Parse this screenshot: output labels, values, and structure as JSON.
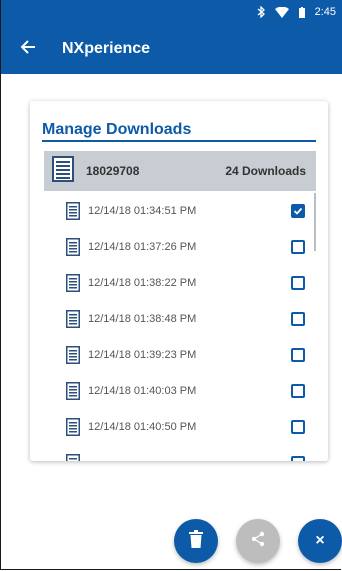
{
  "status_bar": {
    "time": "2:45",
    "icons": [
      "bluetooth-icon",
      "wifi-icon",
      "battery-icon"
    ]
  },
  "app_bar": {
    "title": "NXperience",
    "back_icon": "arrow-left-icon"
  },
  "card": {
    "title": "Manage Downloads",
    "group": {
      "name": "18029708",
      "count": "24 Downloads"
    },
    "downloads": [
      {
        "label": "12/14/18 01:34:51 PM",
        "checked": true
      },
      {
        "label": "12/14/18 01:37:26 PM",
        "checked": false
      },
      {
        "label": "12/14/18 01:38:22 PM",
        "checked": false
      },
      {
        "label": "12/14/18 01:38:48 PM",
        "checked": false
      },
      {
        "label": "12/14/18 01:39:23 PM",
        "checked": false
      },
      {
        "label": "12/14/18 01:40:03 PM",
        "checked": false
      },
      {
        "label": "12/14/18 01:40:50 PM",
        "checked": false
      },
      {
        "label": "",
        "checked": false
      }
    ]
  },
  "fabs": {
    "delete": {
      "icon": "trash-icon",
      "color": "#0d5ba8"
    },
    "share": {
      "icon": "share-icon",
      "color": "#bdbdbd"
    },
    "close": {
      "icon": "close-icon",
      "label": "×",
      "color": "#0d5ba8"
    }
  },
  "colors": {
    "primary": "#0d5ba8",
    "group_bg": "#c8cdd3",
    "disabled": "#bdbdbd"
  }
}
